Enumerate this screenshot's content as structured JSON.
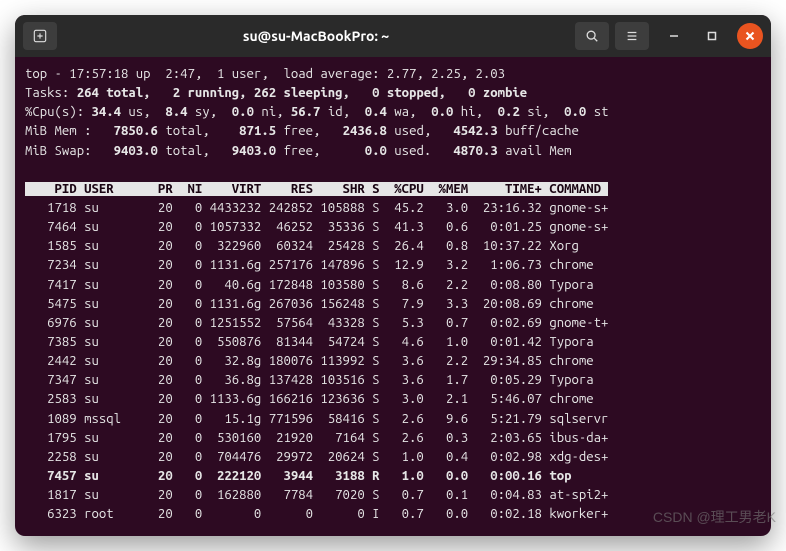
{
  "window": {
    "title": "su@su-MacBookPro: ~"
  },
  "summary": {
    "line1": "top - 17:57:18 up  2:47,  1 user,  load average: 2.77, 2.25, 2.03",
    "tasks_prefix": "Tasks:",
    "tasks_rest": " 264 total,   2 running, 262 sleeping,   0 stopped,   0 zombie",
    "cpu_prefix": "%Cpu(s):",
    "cpu_us": " 34.4 ",
    "cpu_us_lbl": "us,",
    "cpu_sy": "  8.4 ",
    "cpu_sy_lbl": "sy,",
    "cpu_ni": "  0.0 ",
    "cpu_ni_lbl": "ni,",
    "cpu_id": " 56.7 ",
    "cpu_id_lbl": "id,",
    "cpu_wa": "  0.4 ",
    "cpu_wa_lbl": "wa,",
    "cpu_hi": "  0.0 ",
    "cpu_hi_lbl": "hi,",
    "cpu_si": "  0.2 ",
    "cpu_si_lbl": "si,",
    "cpu_st": "  0.0 ",
    "cpu_st_lbl": "st",
    "mem_prefix": "MiB Mem :",
    "mem_total": "   7850.6 ",
    "mem_total_lbl": "total,",
    "mem_free": "    871.5 ",
    "mem_free_lbl": "free,",
    "mem_used": "   2436.8 ",
    "mem_used_lbl": "used,",
    "mem_buff": "   4542.3 ",
    "mem_buff_lbl": "buff/cache",
    "swap_prefix": "MiB Swap:",
    "swap_total": "   9403.0 ",
    "swap_total_lbl": "total,",
    "swap_free": "   9403.0 ",
    "swap_free_lbl": "free,",
    "swap_used": "      0.0 ",
    "swap_used_lbl": "used.",
    "swap_avail": "   4870.3 ",
    "swap_avail_lbl": "avail Mem"
  },
  "header": "    PID USER      PR  NI    VIRT    RES    SHR S  %CPU  %MEM     TIME+ COMMAND ",
  "processes": [
    {
      "line": "   1718 su        20   0 4433232 242852 105888 S  45.2   3.0  23:16.32 gnome-s+",
      "bold": false
    },
    {
      "line": "   7464 su        20   0 1057332  46252  35336 S  41.3   0.6   0:01.25 gnome-s+",
      "bold": false
    },
    {
      "line": "   1585 su        20   0  322960  60324  25428 S  26.4   0.8  10:37.22 Xorg",
      "bold": false
    },
    {
      "line": "   7234 su        20   0 1131.6g 257176 147896 S  12.9   3.2   1:06.73 chrome",
      "bold": false
    },
    {
      "line": "   7417 su        20   0   40.6g 172848 103580 S   8.6   2.2   0:08.80 Typora",
      "bold": false
    },
    {
      "line": "   5475 su        20   0 1131.6g 267036 156248 S   7.9   3.3  20:08.69 chrome",
      "bold": false
    },
    {
      "line": "   6976 su        20   0 1251552  57564  43328 S   5.3   0.7   0:02.69 gnome-t+",
      "bold": false
    },
    {
      "line": "   7385 su        20   0  550876  81344  54724 S   4.6   1.0   0:01.42 Typora",
      "bold": false
    },
    {
      "line": "   2442 su        20   0   32.8g 180076 113992 S   3.6   2.2  29:34.85 chrome",
      "bold": false
    },
    {
      "line": "   7347 su        20   0   36.8g 137428 103516 S   3.6   1.7   0:05.29 Typora",
      "bold": false
    },
    {
      "line": "   2583 su        20   0 1133.6g 166216 123636 S   3.0   2.1   5:46.07 chrome",
      "bold": false
    },
    {
      "line": "   1089 mssql     20   0   15.1g 771596  58416 S   2.6   9.6   5:21.79 sqlservr",
      "bold": false
    },
    {
      "line": "   1795 su        20   0  530160  21920   7164 S   2.6   0.3   2:03.65 ibus-da+",
      "bold": false
    },
    {
      "line": "   2258 su        20   0  704476  29972  20624 S   1.0   0.4   0:02.98 xdg-des+",
      "bold": false
    },
    {
      "line": "   7457 su        20   0  222120   3944   3188 R   1.0   0.0   0:00.16 top",
      "bold": true
    },
    {
      "line": "   1817 su        20   0  162880   7784   7020 S   0.7   0.1   0:04.83 at-spi2+",
      "bold": false
    },
    {
      "line": "   6323 root      20   0       0      0      0 I   0.7   0.0   0:02.18 kworker+",
      "bold": false
    }
  ],
  "watermark": "CSDN @理工男老K"
}
